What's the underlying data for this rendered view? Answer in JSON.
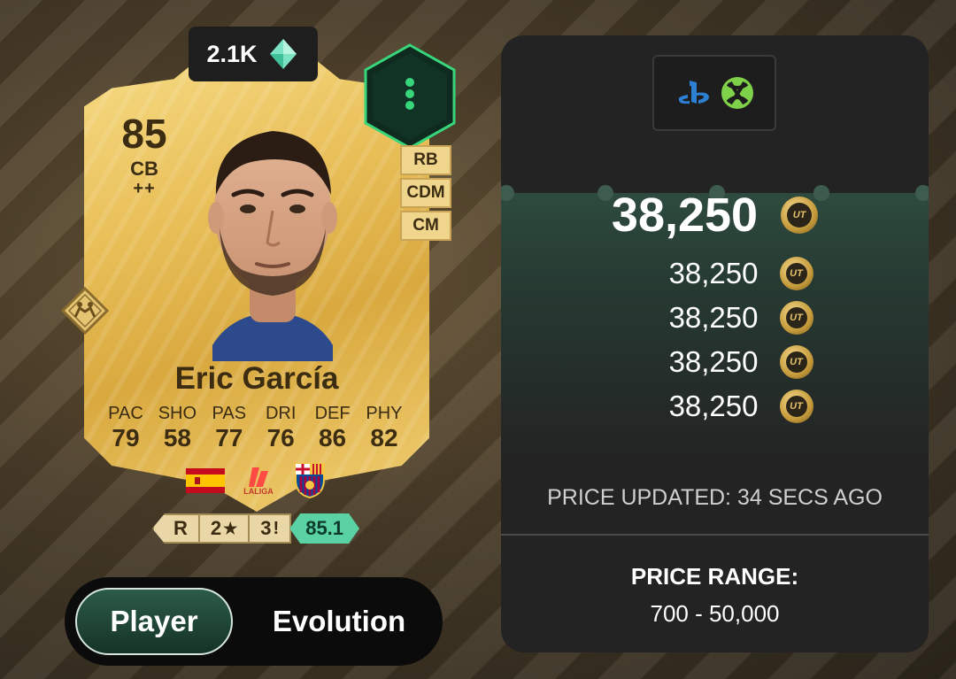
{
  "card": {
    "price_tag": "2.1K",
    "rating": "85",
    "position": "CB",
    "plus": "++",
    "name": "Eric García",
    "alt_positions": [
      "RB",
      "CDM",
      "CM"
    ],
    "stats": [
      {
        "label": "PAC",
        "value": "79"
      },
      {
        "label": "SHO",
        "value": "58"
      },
      {
        "label": "PAS",
        "value": "77"
      },
      {
        "label": "DRI",
        "value": "76"
      },
      {
        "label": "DEF",
        "value": "86"
      },
      {
        "label": "PHY",
        "value": "82"
      }
    ],
    "league_label": "LALIGA",
    "chips": {
      "foot": "R",
      "skill_moves": "2",
      "weak_foot": "3",
      "ovr": "85.1"
    },
    "icons": [
      "gem-icon",
      "evolution-hex-icon",
      "role-badge-icon",
      "spain-flag-icon",
      "laliga-logo-icon",
      "barcelona-crest-icon",
      "star-icon",
      "exclamation-icon"
    ]
  },
  "toggle": {
    "options": [
      "Player",
      "Evolution"
    ],
    "selected": "Player"
  },
  "price_panel": {
    "platforms": [
      "playstation-icon",
      "xbox-icon"
    ],
    "main_price": "38,250",
    "listings": [
      "38,250",
      "38,250",
      "38,250",
      "38,250"
    ],
    "coin_label": "UT",
    "updated": "PRICE UPDATED: 34 SECS AGO",
    "range_label": "PRICE RANGE:",
    "range_value": "700 - 50,000"
  },
  "colors": {
    "card_gold": "#e8be57",
    "card_text": "#3b2c12",
    "panel_bg": "#232323",
    "accent_green": "#5bd2a4",
    "toggle_active": "#2c5b48"
  }
}
